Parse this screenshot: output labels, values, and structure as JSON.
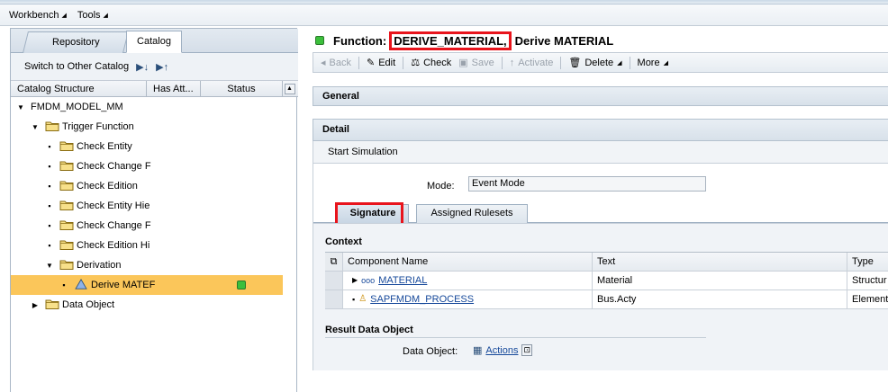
{
  "menubar": {
    "items": [
      "Workbench",
      "Tools"
    ]
  },
  "left": {
    "tabs": [
      "Repository",
      "Catalog"
    ],
    "switch_label": "Switch to Other Catalog",
    "columns": [
      "Catalog Structure",
      "Has Att...",
      "Status"
    ],
    "tree": [
      {
        "label": "FMDM_MODEL_MM",
        "level": 0,
        "kind": "expanded",
        "icon": "none"
      },
      {
        "label": "Trigger Function",
        "level": 1,
        "kind": "expanded",
        "icon": "folder"
      },
      {
        "label": "Check Entity",
        "level": 2,
        "kind": "leaf",
        "icon": "folder"
      },
      {
        "label": "Check Change F",
        "level": 2,
        "kind": "leaf",
        "icon": "folder"
      },
      {
        "label": "Check Edition",
        "level": 2,
        "kind": "leaf",
        "icon": "folder"
      },
      {
        "label": "Check Entity Hie",
        "level": 2,
        "kind": "leaf",
        "icon": "folder"
      },
      {
        "label": "Check Change F",
        "level": 2,
        "kind": "leaf",
        "icon": "folder"
      },
      {
        "label": "Check Edition Hi",
        "level": 2,
        "kind": "leaf",
        "icon": "folder"
      },
      {
        "label": "Derivation",
        "level": 2,
        "kind": "expanded",
        "icon": "folder"
      },
      {
        "label": "Derive MATEF",
        "level": 3,
        "kind": "leaf",
        "icon": "triangle",
        "selected": true,
        "status": "green"
      },
      {
        "label": "Data Object",
        "level": 1,
        "kind": "collapsed",
        "icon": "folder"
      }
    ]
  },
  "function": {
    "label": "Function:",
    "name": "DERIVE_MATERIAL,",
    "desc": "Derive MATERIAL"
  },
  "toolbar": {
    "back": "Back",
    "edit": "Edit",
    "check": "Check",
    "save": "Save",
    "activate": "Activate",
    "delete": "Delete",
    "more": "More"
  },
  "panels": {
    "general": "General",
    "detail": "Detail",
    "start_simulation": "Start Simulation"
  },
  "mode": {
    "label": "Mode:",
    "value": "Event Mode"
  },
  "subtabs": [
    "Signature",
    "Assigned Rulesets"
  ],
  "context": {
    "label": "Context",
    "columns": [
      "Component Name",
      "Text",
      "Type"
    ],
    "rows": [
      {
        "name": "MATERIAL",
        "text": "Material",
        "type": "Structur"
      },
      {
        "name": "SAPFMDM_PROCESS",
        "text": "Bus.Acty",
        "type": "Element"
      }
    ]
  },
  "result": {
    "label": "Result Data Object",
    "data_object_label": "Data Object:",
    "data_object_value": "Actions"
  }
}
